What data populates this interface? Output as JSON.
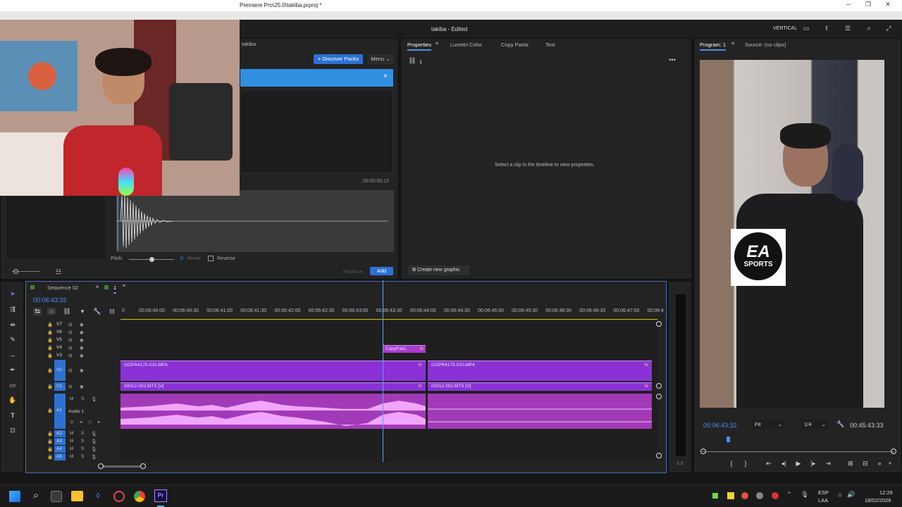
{
  "window": {
    "title": "Premiere Pro\\25.0\\takiba.prproj *"
  },
  "header": {
    "project_status": "takiba - Edited",
    "layout_label": "VERTICAL"
  },
  "left_panel": {
    "tab_label": "takiba",
    "discover_packs": "+ Discover Packs",
    "menu": "Menu",
    "close_symbol": "×",
    "duration": "00:00:00:13",
    "pitch_label": "Pitch:",
    "pitch_value": "0",
    "reset_label": "Reset",
    "reverse_label": "Reverse",
    "replace_label": "Replace",
    "add_label": "Add"
  },
  "properties_panel": {
    "tabs": [
      "Properties",
      "Lumetri Color",
      "Copy Pasta",
      "Text"
    ],
    "count": "1",
    "empty_message": "Select a clip in the timeline to view properties.",
    "create_graphic": "Create new graphic"
  },
  "program_monitor": {
    "tabs": [
      "Program: 1",
      "Source: (no clips)"
    ],
    "current_time": "00:06:43:32",
    "fit": "Fit",
    "resolution": "1/4",
    "duration": "00:45:43:33",
    "overlay_logo_line1": "EA",
    "overlay_logo_line2": "SPORTS"
  },
  "timeline": {
    "sequence_name": "Sequence 02",
    "sequence_number": "1",
    "current_time": "00:06:43:32",
    "ruler_ticks": [
      "0",
      "00:06:40:00",
      "00:06:40:30",
      "00:06:41:00",
      "00:06:41:30",
      "00:06:42:00",
      "00:06:42:30",
      "00:06:43:00",
      "00:06:43:30",
      "00:06:44:00",
      "00:06:44:30",
      "00:06:45:00",
      "00:06:45:30",
      "00:06:46:00",
      "00:06:46:30",
      "00:06:47:00",
      "00:06:4"
    ],
    "video_tracks": [
      "V7",
      "V6",
      "V5",
      "V4",
      "V3",
      "V2",
      "V1"
    ],
    "audio_tracks": [
      "A1",
      "A2",
      "A3",
      "A4",
      "A5"
    ],
    "audio1_name": "Audio 1",
    "clips": {
      "copypasta": "CopyPast...",
      "v2_left": "GOPR4175-010.MP4",
      "v2_right": "GOPR4175-010.MP4",
      "v1_left": "00012-002.MTS [V]",
      "v1_right": "00012-002.MTS [V]",
      "fx": "fx"
    },
    "meter_label": "S S"
  },
  "taskbar": {
    "lang_line1": "ESP",
    "lang_line2": "LAA",
    "time": "12:26",
    "date": "18/02/2026"
  },
  "colors": {
    "accent_blue": "#2d71d2",
    "clip_purple": "#8a32d6",
    "audio_pink": "#d55ee8",
    "playhead": "#5aa0ff"
  }
}
